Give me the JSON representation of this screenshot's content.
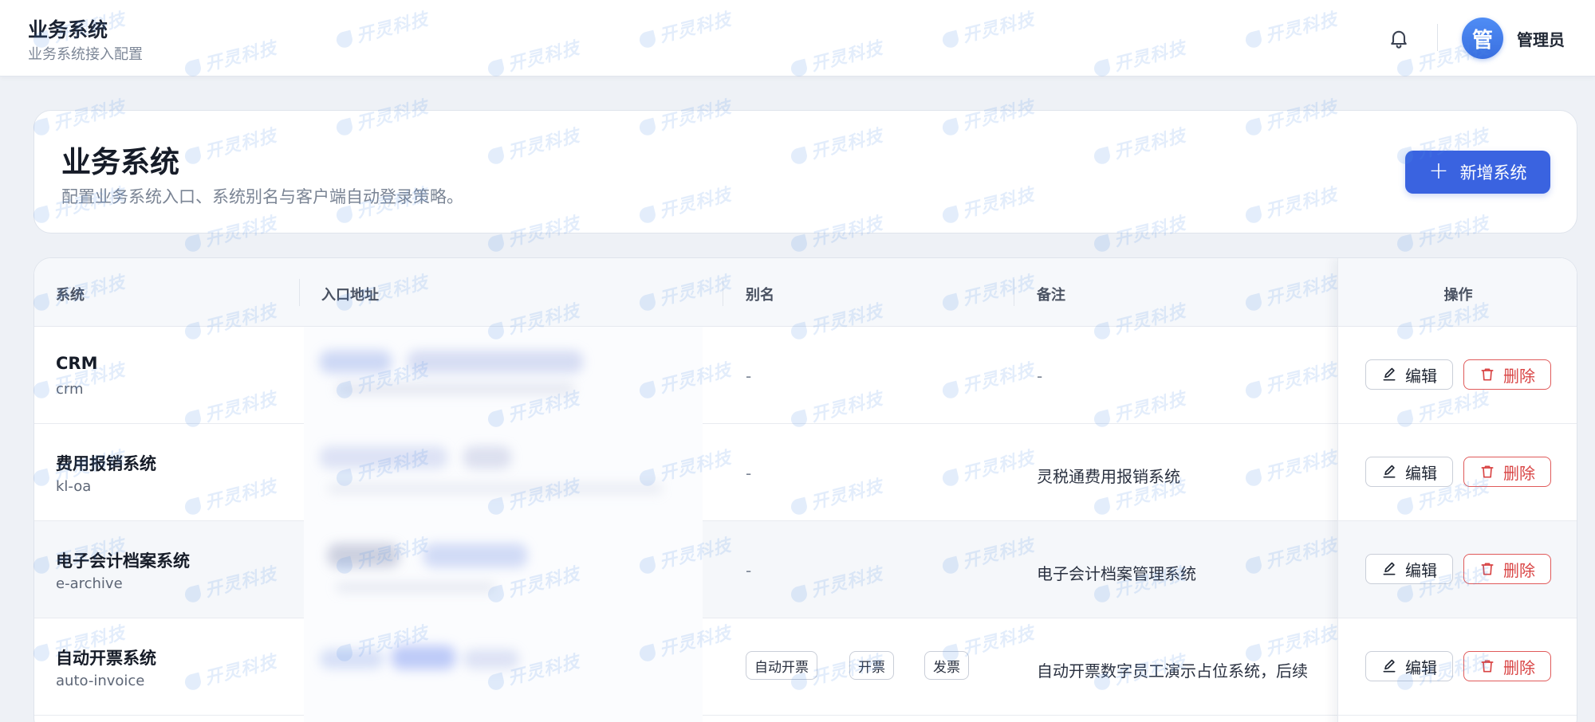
{
  "header": {
    "title": "业务系统",
    "subtitle": "业务系统接入配置",
    "avatar_char": "管",
    "user_name": "管理员"
  },
  "intro": {
    "title": "业务系统",
    "description": "配置业务系统入口、系统别名与客户端自动登录策略。",
    "add_button_label": "新增系统"
  },
  "table": {
    "columns": {
      "system": "系统",
      "entry_url": "入口地址",
      "alias": "别名",
      "note": "备注",
      "actions": "操作"
    },
    "rows": [
      {
        "name": "CRM",
        "code": "crm",
        "alias": "-",
        "aliases": [],
        "note": "-"
      },
      {
        "name": "费用报销系统",
        "code": "kl-oa",
        "alias": "-",
        "aliases": [],
        "note": "灵税通费用报销系统"
      },
      {
        "name": "电子会计档案系统",
        "code": "e-archive",
        "alias": "-",
        "aliases": [],
        "note": "电子会计档案管理系统"
      },
      {
        "name": "自动开票系统",
        "code": "auto-invoice",
        "alias": "",
        "aliases": [
          "自动开票",
          "开票",
          "发票"
        ],
        "note": "自动开票数字员工演示占位系统，后续"
      }
    ],
    "edit_label": "编辑",
    "delete_label": "删除"
  },
  "watermark": "开灵科技",
  "colors": {
    "primary": "#3a63e0",
    "danger": "#d94444",
    "background": "#eef1f6"
  }
}
